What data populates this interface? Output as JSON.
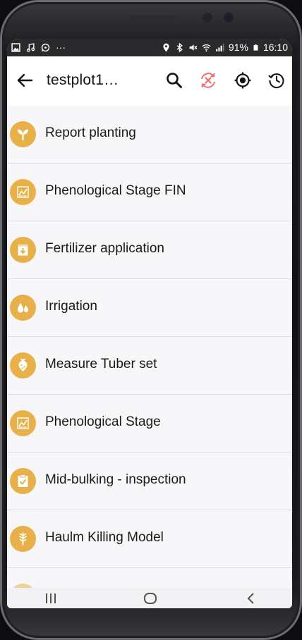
{
  "status_bar": {
    "dots": "···",
    "battery_text": "91%",
    "time": "16:10"
  },
  "app_bar": {
    "title": "testplot1…",
    "actions": [
      "search-icon",
      "sync-error-icon",
      "location-target-icon",
      "history-icon"
    ]
  },
  "colors": {
    "accent": "#e8b048",
    "sync_error": "#ef6b6b",
    "background": "#f7f7f9"
  },
  "items": [
    {
      "label": "Report planting",
      "icon": "sprout-icon"
    },
    {
      "label": "Phenological Stage FIN",
      "icon": "chart-icon"
    },
    {
      "label": "Fertilizer application",
      "icon": "fertilizer-box-icon"
    },
    {
      "label": "Irrigation",
      "icon": "water-drops-icon"
    },
    {
      "label": "Measure Tuber set",
      "icon": "tuber-icon"
    },
    {
      "label": "Phenological Stage",
      "icon": "chart-icon"
    },
    {
      "label": "Mid-bulking - inspection",
      "icon": "clipboard-check-icon"
    },
    {
      "label": "Haulm Killing Model",
      "icon": "plant-stem-icon"
    }
  ]
}
